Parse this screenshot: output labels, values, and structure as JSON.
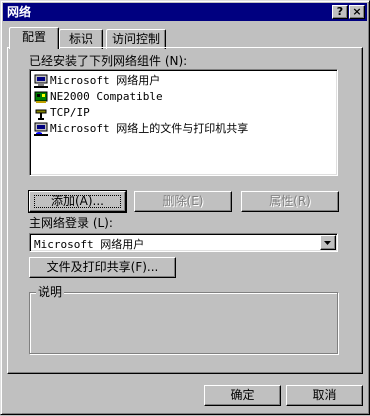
{
  "window": {
    "title": "网络",
    "help_label": "?",
    "close_label": "×"
  },
  "tabs": [
    {
      "label": "配置",
      "active": true
    },
    {
      "label": "标识",
      "active": false
    },
    {
      "label": "访问控制",
      "active": false
    }
  ],
  "components": {
    "label": "已经安装了下列网络组件 (N):",
    "items": [
      {
        "label": "Microsoft 网络用户",
        "icon": "network-client-icon"
      },
      {
        "label": "NE2000 Compatible",
        "icon": "network-adapter-icon"
      },
      {
        "label": "TCP/IP",
        "icon": "protocol-icon"
      },
      {
        "label": "Microsoft 网络上的文件与打印机共享",
        "icon": "file-print-sharing-icon"
      }
    ]
  },
  "buttons": {
    "add": "添加(A)...",
    "remove": "删除(E)",
    "properties": "属性(R)"
  },
  "primary_logon": {
    "label": "主网络登录 (L):",
    "value": "Microsoft 网络用户"
  },
  "file_print_sharing_button": "文件及打印共享(F)...",
  "description": {
    "legend": "说明",
    "text": ""
  },
  "dialog_buttons": {
    "ok": "确定",
    "cancel": "取消"
  },
  "colors": {
    "titlebar": "#000080",
    "face": "#c0c0c0"
  }
}
